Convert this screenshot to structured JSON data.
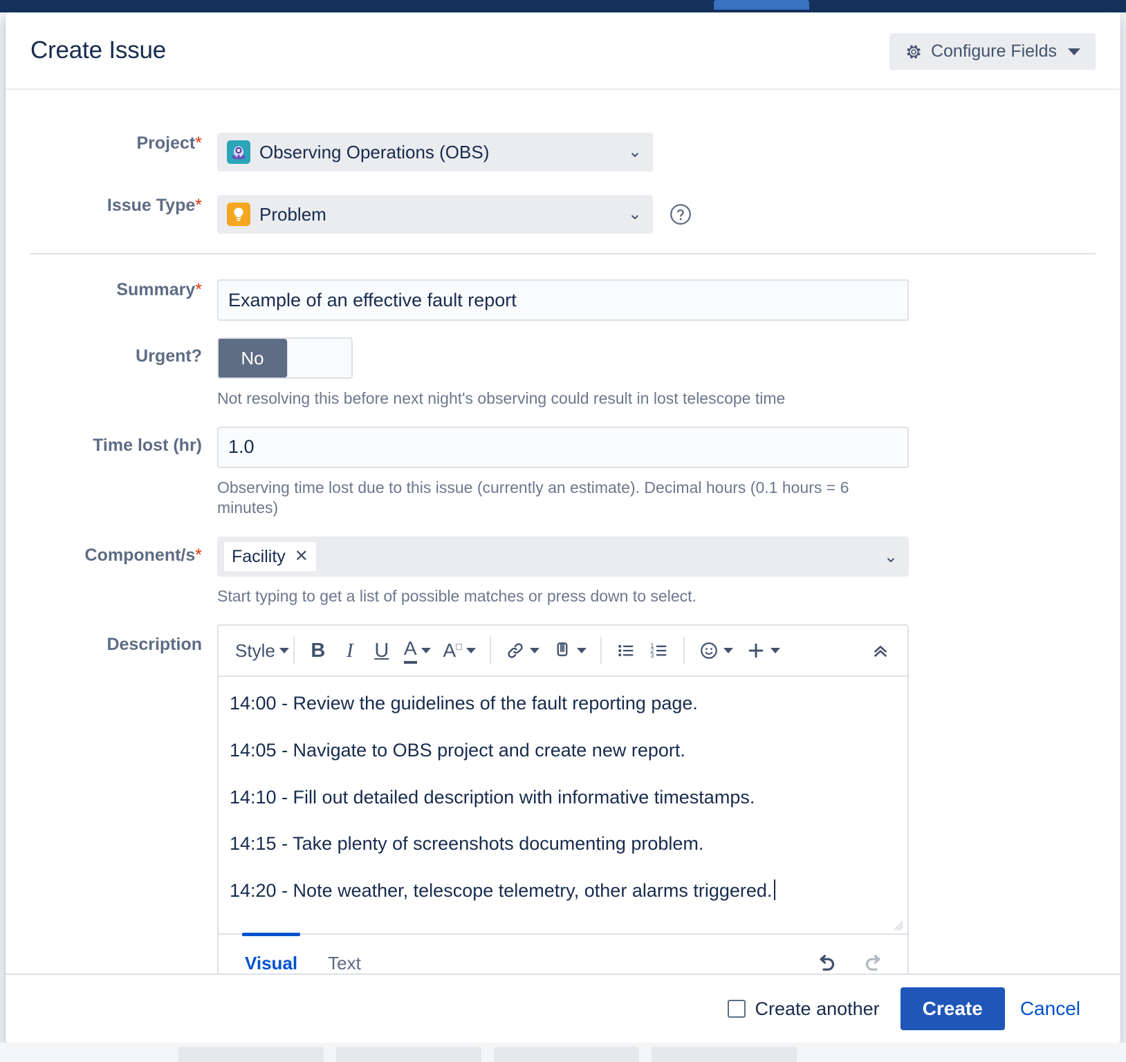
{
  "window": {
    "title": "Create Issue"
  },
  "header": {
    "title": "Create Issue",
    "configure_fields_label": "Configure Fields",
    "gear_icon": "gear-icon",
    "caret_icon": "chevron-down-icon"
  },
  "fields": {
    "project": {
      "label": "Project",
      "required_mark": "*",
      "value": "Observing Operations (OBS)",
      "avatar_icon": "project-telescope-avatar",
      "chevron": "⌄"
    },
    "issue_type": {
      "label": "Issue Type",
      "required_mark": "*",
      "value": "Problem",
      "avatar_icon": "issue-type-problem-bulb-avatar",
      "chevron": "⌄",
      "help_icon": "question-circle-icon"
    },
    "summary": {
      "label": "Summary",
      "required_mark": "*",
      "value": "Example of an effective fault report",
      "placeholder": ""
    },
    "urgent": {
      "label": "Urgent?",
      "toggle_value": "No",
      "help": "Not resolving this before next night's observing could result in lost telescope time"
    },
    "time_lost": {
      "label": "Time lost (hr)",
      "value": "1.0",
      "placeholder": "",
      "help": "Observing time lost due to this issue (currently an estimate). Decimal hours (0.1 hours = 6 minutes)"
    },
    "components": {
      "label": "Component/s",
      "required_mark": "*",
      "chips": [
        {
          "label": "Facility",
          "remove_icon": "close-x-icon"
        }
      ],
      "chevron": "⌄",
      "help": "Start typing to get a list of possible matches or press down to select."
    },
    "description": {
      "label": "Description",
      "toolbar": {
        "style_label": "Style",
        "bold_label": "B",
        "italic_label": "I",
        "underline_label": "U",
        "text_color_label": "A",
        "text_highlight_label": "A",
        "link_icon": "link-icon",
        "attach_icon": "paperclip-icon",
        "bullet_list_icon": "bullet-list-icon",
        "numbered_list_icon": "numbered-list-icon",
        "emoji_icon": "emoji-smiley-icon",
        "insert_more_icon": "plus-icon",
        "collapse_icon": "chevron-double-up-icon"
      },
      "lines": [
        "14:00 - Review the guidelines of the fault reporting page.",
        "14:05 - Navigate to OBS project and create new report.",
        "14:10 - Fill out detailed description with informative timestamps.",
        "14:15 - Take plenty of screenshots documenting problem.",
        "14:20 - Note weather, telescope telemetry, other alarms triggered."
      ],
      "tabs": [
        {
          "label": "Visual",
          "active": true
        },
        {
          "label": "Text",
          "active": false
        }
      ],
      "undo_icon": "undo-arrow-icon",
      "redo_icon": "redo-arrow-icon",
      "resize_icon": "resize-grip-icon"
    }
  },
  "footer": {
    "create_another_label": "Create another",
    "create_another_checked": false,
    "create_label": "Create",
    "cancel_label": "Cancel"
  },
  "colors": {
    "accent_blue": "#0052cc",
    "create_button_blue": "#1f56b8",
    "required_red": "#de350b",
    "label_gray": "#5e6c84",
    "text_navy": "#172b4d",
    "field_gray": "#ebecf0",
    "top_strip_navy": "#16325c"
  }
}
